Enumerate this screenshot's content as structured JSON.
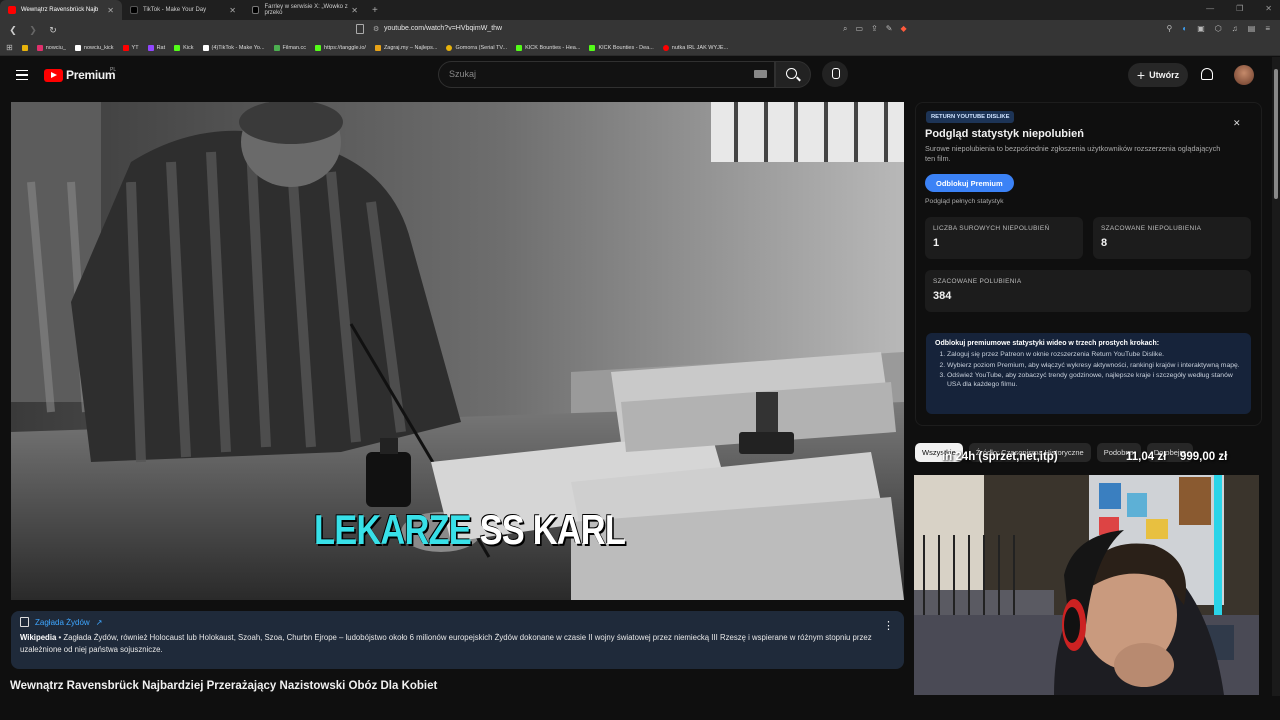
{
  "browser": {
    "tabs": [
      {
        "label": "Wewnątrz Ravensbrück Najb",
        "active": true
      },
      {
        "label": "TikTok - Make Your Day",
        "active": false
      },
      {
        "label": "Farrley w serwisie X: „Wowko z przeko",
        "active": false
      }
    ],
    "url": "youtube.com/watch?v=HVbqimW_thw",
    "bookmarks": [
      "nowciu_",
      "nowciu_kick",
      "YT",
      "Rat",
      "Kick",
      "(4)TikTok - Make Yo...",
      "Filman.cc",
      "https://tanggle.io/",
      "Zagraj.my – Najleps...",
      "Gomorra (Serial TV...",
      "KICK Bounties - Hea...",
      "KICK Bounties - Dea...",
      "nutka IRL JAK WYJE..."
    ],
    "bookmark_colors": [
      "#e8b30b",
      "#e1306c",
      "#ffffff",
      "#ff0000",
      "#9146ff",
      "#53fc18",
      "#ffffff",
      "#4caf50",
      "#53fc18",
      "#e8a317",
      "#e8b30b",
      "#53fc18",
      "#53fc18",
      "#ff0000"
    ]
  },
  "youtube": {
    "logo_text": "Premium",
    "logo_region": "PL",
    "search_placeholder": "Szukaj",
    "create_label": "Utwórz"
  },
  "video": {
    "caption_part1": "LEKARZE",
    "caption_part2": "SS KARL",
    "info_topic": "Zagłada Żydów",
    "info_source": "Wikipedia",
    "info_text": " • Zagłada Żydów, również Holocaust lub Holokaust, Szoah, Szoa, Churbn Ejrope – ludobójstwo około 6 milionów europejskich Żydów dokonane w czasie II wojny światowej przez niemiecką III Rzeszę i wspierane w różnym stopniu przez uzależnione od niej państwa sojusznicze.",
    "title": "Wewnątrz Ravensbrück Najbardziej Przerażający Nazistowski Obóz Dla Kobiet"
  },
  "rydPanel": {
    "badge": "RETURN YOUTUBE DISLIKE",
    "title": "Podgląd statystyk niepolubień",
    "subtitle": "Surowe niepolubienia to bezpośrednie zgłoszenia użytkowników rozszerzenia oglądających ten film.",
    "unlock_button": "Odblokuj Premium",
    "full_stats": "Podgląd pełnych statystyk",
    "stats": [
      {
        "label": "LICZBA SUROWYCH NIEPOLUBIEŃ",
        "value": "1"
      },
      {
        "label": "SZACOWANE NIEPOLUBIENIA",
        "value": "8"
      },
      {
        "label": "SZACOWANE POLUBIENIA",
        "value": "384"
      }
    ],
    "steps_title": "Odblokuj premiumowe statystyki wideo w trzech prostych krokach:",
    "steps": [
      "Zaloguj się przez Patreon w oknie rozszerzenia Return YouTube Dislike.",
      "Wybierz poziom Premium, aby włączyć wykresy aktywności, rankingi krajów i interaktywną mapę.",
      "Odśwież YouTube, aby zobaczyć trendy godzinowe, najlepsze kraje i szczegóły według stanów USA dla każdego filmu."
    ]
  },
  "chips": [
    "Wszystkie",
    "Źródło: Czasopisma Historyczne",
    "Podobne",
    "Do obejrz"
  ],
  "streamOverlay": {
    "text1": "in 24h (sprzet,net,itp)",
    "text2": "11,04 zł",
    "text3": "999,00 zł"
  }
}
